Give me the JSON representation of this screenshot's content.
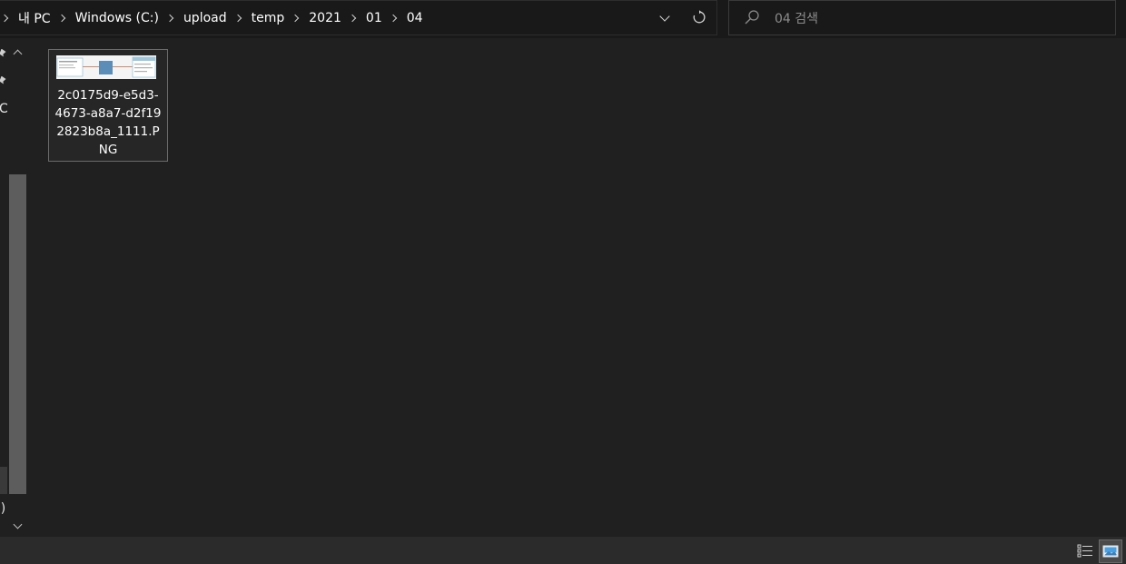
{
  "address_bar": {
    "crumbs": [
      "내 PC",
      "Windows (C:)",
      "upload",
      "temp",
      "2021",
      "01",
      "04"
    ]
  },
  "search": {
    "placeholder": "04 검색"
  },
  "nav": {
    "partial_labels": [
      "C",
      ":)"
    ]
  },
  "files": [
    {
      "name": "2c0175d9-e5d3-4673-a8a7-d2f192823b8a_1111.PNG",
      "name_lines": [
        "2c0175d9-e5d3-",
        "4673-a8a7-d2f19",
        "2823b8a_1111.P",
        "NG"
      ]
    }
  ],
  "colors": {
    "background": "#202020",
    "toolbar": "#191919",
    "statusbar": "#2b2b2b",
    "selection_border": "#6b6b6b",
    "text": "#ffffff",
    "placeholder": "#8c8c8c"
  },
  "icons": {
    "dropdown": "chevron-down-icon",
    "refresh": "refresh-icon",
    "search": "search-icon",
    "details_view": "details-view-icon",
    "large_icons_view": "large-icons-view-icon"
  }
}
